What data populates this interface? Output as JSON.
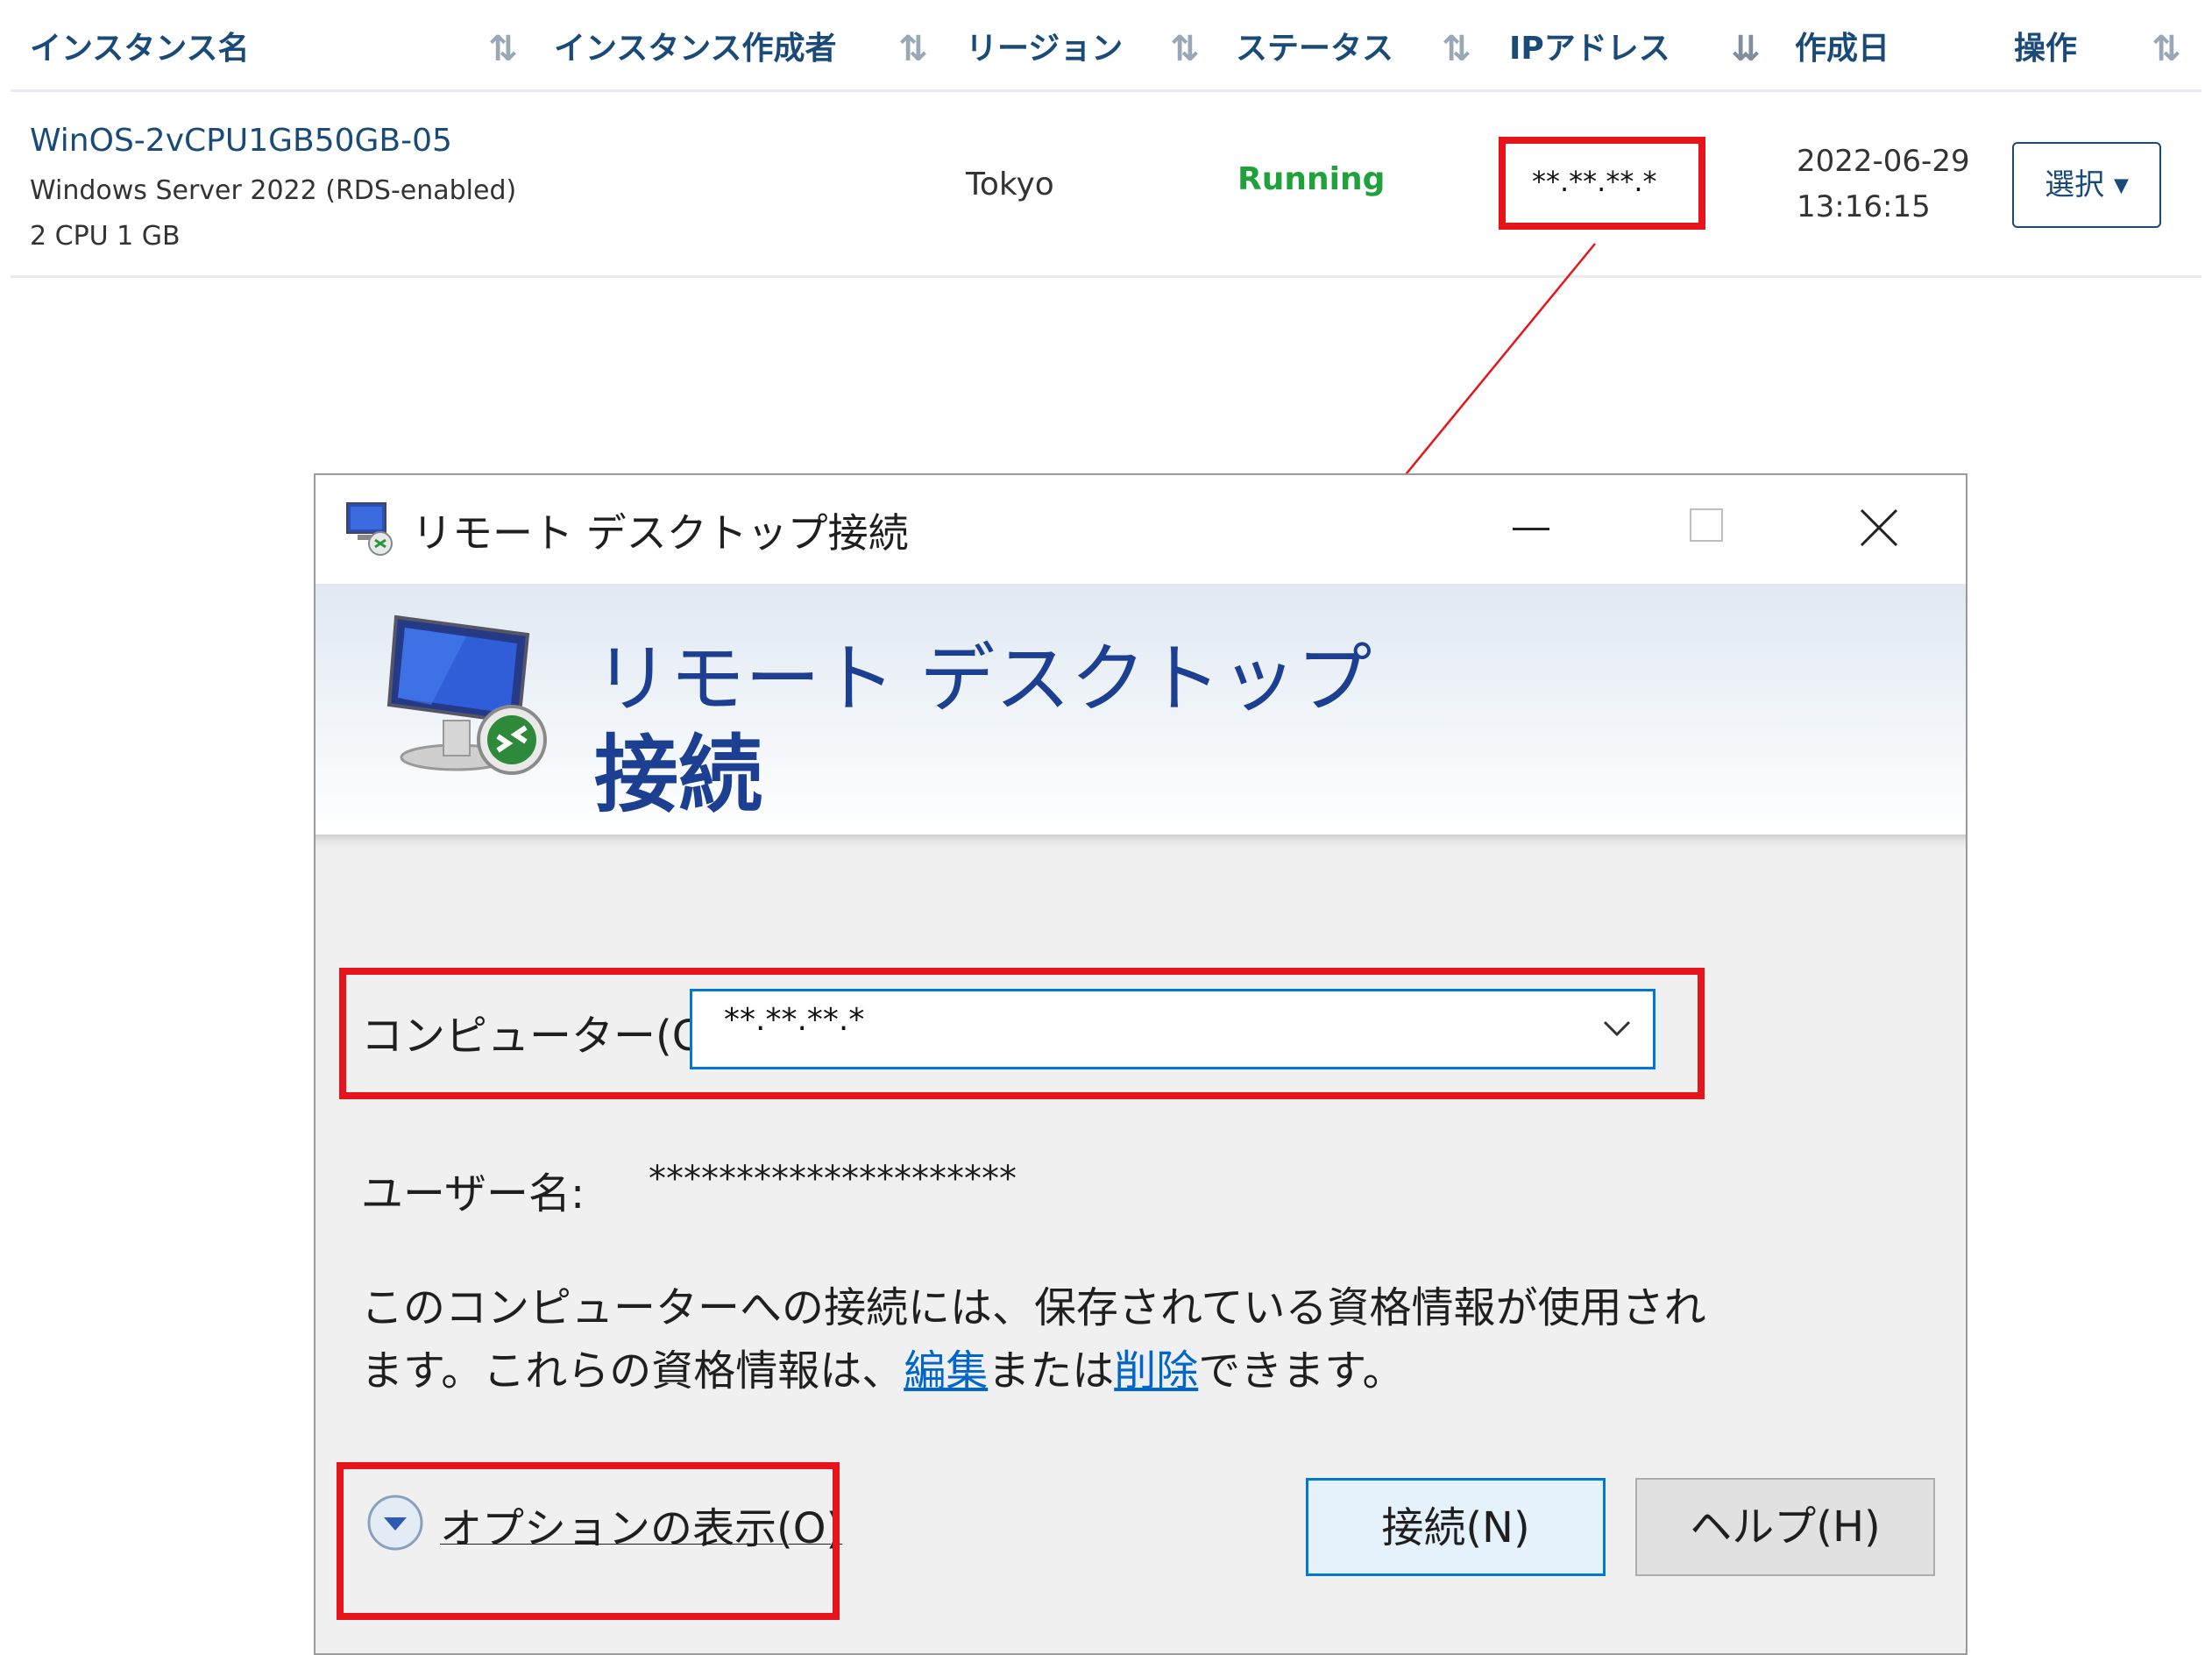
{
  "table": {
    "headers": [
      "インスタンス名",
      "インスタンス作成者",
      "リージョン",
      "ステータス",
      "IPアドレス",
      "作成日",
      "操作"
    ],
    "row": {
      "instance_name": "WinOS-2vCPU1GB50GB-05",
      "os": "Windows Server 2022 (RDS-enabled)",
      "spec": "2 CPU 1 GB",
      "region": "Tokyo",
      "status": "Running",
      "ip": "**.**.**.*",
      "created_date": "2022-06-29",
      "created_time": "13:16:15",
      "action_button": "選択"
    }
  },
  "dialog": {
    "window_title": "リモート デスクトップ接続",
    "banner_line1": "リモート デスクトップ",
    "banner_line2": "接続",
    "computer_label": "コンピューター(C):",
    "computer_value": "**.**.**.*",
    "username_label": "ユーザー名:",
    "username_value": "*********************",
    "info_line1": "このコンピューターへの接続には、保存されている資格情報が使用され",
    "info_line2_a": "ます。これらの資格情報は、",
    "info_edit_link": "編集",
    "info_line2_b": "または",
    "info_delete_link": "削除",
    "info_line2_c": "できます。",
    "options_label": "オプションの表示(O)",
    "connect_button": "接続(N)",
    "help_button": "ヘルプ(H)"
  },
  "colors": {
    "header_text": "#1a4a78",
    "status_running": "#1fa13b",
    "highlight_red": "#e8141c",
    "link": "#0066cc",
    "focus_blue": "#0078d7"
  }
}
